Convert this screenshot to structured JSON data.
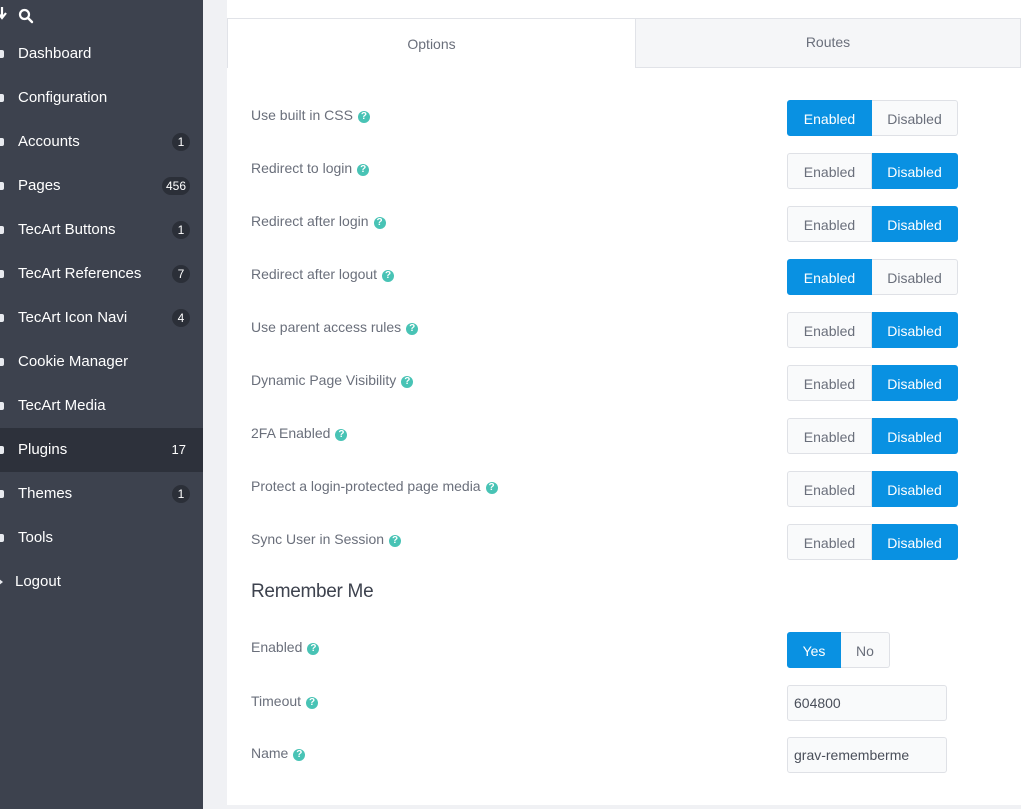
{
  "sidebar": {
    "items": [
      {
        "label": "Dashboard",
        "badge": ""
      },
      {
        "label": "Configuration",
        "badge": ""
      },
      {
        "label": "Accounts",
        "badge": "1"
      },
      {
        "label": "Pages",
        "badge": "456"
      },
      {
        "label": "TecArt Buttons",
        "badge": "1"
      },
      {
        "label": "TecArt References",
        "badge": "7"
      },
      {
        "label": "TecArt Icon Navi",
        "badge": "4"
      },
      {
        "label": "Cookie Manager",
        "badge": ""
      },
      {
        "label": "TecArt Media",
        "badge": ""
      },
      {
        "label": "Plugins",
        "badge": "17",
        "active": true
      },
      {
        "label": "Themes",
        "badge": "1"
      },
      {
        "label": "Tools",
        "badge": ""
      },
      {
        "label": "Logout",
        "badge": ""
      }
    ]
  },
  "tabs": {
    "options": "Options",
    "routes": "Routes"
  },
  "toggle_labels": {
    "enabled": "Enabled",
    "disabled": "Disabled",
    "yes": "Yes",
    "no": "No"
  },
  "help_glyph": "?",
  "settings": [
    {
      "label": "Use built in CSS",
      "value": "enabled"
    },
    {
      "label": "Redirect to login",
      "value": "disabled"
    },
    {
      "label": "Redirect after login",
      "value": "disabled"
    },
    {
      "label": "Redirect after logout",
      "value": "enabled"
    },
    {
      "label": "Use parent access rules",
      "value": "disabled"
    },
    {
      "label": "Dynamic Page Visibility",
      "value": "disabled"
    },
    {
      "label": "2FA Enabled",
      "value": "disabled"
    },
    {
      "label": "Protect a login-protected page media",
      "value": "disabled"
    },
    {
      "label": "Sync User in Session",
      "value": "disabled"
    }
  ],
  "remember_me": {
    "title": "Remember Me",
    "enabled_label": "Enabled",
    "enabled_value": "yes",
    "timeout_label": "Timeout",
    "timeout_value": "604800",
    "name_label": "Name",
    "name_value": "grav-rememberme"
  },
  "colors": {
    "sidebar_bg": "#3d424e",
    "sidebar_active": "#2d313b",
    "accent": "#0991e2",
    "help_icon": "#48c3b5"
  }
}
